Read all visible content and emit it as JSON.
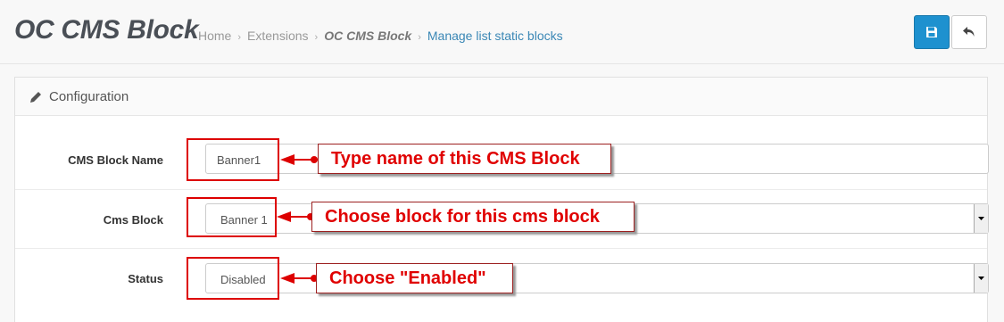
{
  "header": {
    "title": "OC CMS Block",
    "breadcrumb": [
      "Home",
      "Extensions",
      "OC CMS Block",
      "Manage list static blocks"
    ],
    "separator": "›"
  },
  "toolbar": {
    "save_icon": "floppy-disk-icon",
    "back_icon": "reply-arrow-icon",
    "accent": "#1e91cf"
  },
  "panel": {
    "title": "Configuration",
    "icon": "pencil-icon"
  },
  "form": {
    "name": {
      "label": "CMS Block Name",
      "value": "Banner1"
    },
    "block": {
      "label": "Cms Block",
      "value": "Banner 1"
    },
    "status": {
      "label": "Status",
      "value": "Disabled"
    }
  },
  "annotations": {
    "name": "Type name of this CMS Block",
    "block": "Choose block for this cms block",
    "status": "Choose \"Enabled\"",
    "color": "#dd0000"
  }
}
